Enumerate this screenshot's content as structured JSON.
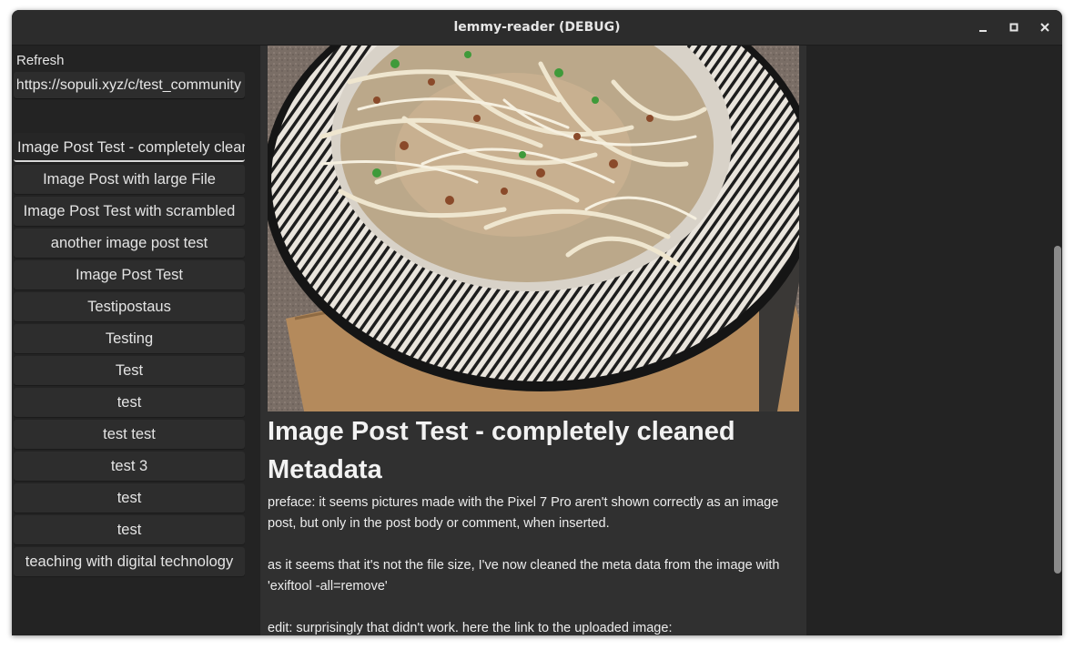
{
  "window": {
    "title": "lemmy-reader (DEBUG)",
    "controls": [
      "minimize-icon",
      "maximize-icon",
      "close-icon"
    ]
  },
  "sidebar": {
    "refresh_label": "Refresh",
    "community_url": "https://sopuli.xyz/c/test_community",
    "posts": [
      "Image Post Test - completely cleaned Metadata",
      "Image Post with large File",
      "Image Post Test with scrambled",
      "another image post test",
      "Image Post Test",
      "Testipostaus",
      "Testing",
      "Test",
      "test",
      "test test",
      "test 3",
      "test",
      "test",
      "teaching with digital technology"
    ]
  },
  "post": {
    "title": "Image Post Test - completely cleaned Metadata",
    "body": [
      "preface: it seems pictures made with the Pixel 7 Pro aren't shown correctly as an image post, but only in the post body or comment, when inserted.",
      "as it seems that it's not the file size, I've now cleaned the meta data from the image with 'exiftool -all=remove'",
      "edit: surprisingly that didn't work. here the link to the uploaded image:"
    ]
  },
  "colors": {
    "window_bg": "#232323",
    "titlebar": "#2c2c2c",
    "content_bg": "#303030",
    "button_bg": "#2d2d2d"
  }
}
